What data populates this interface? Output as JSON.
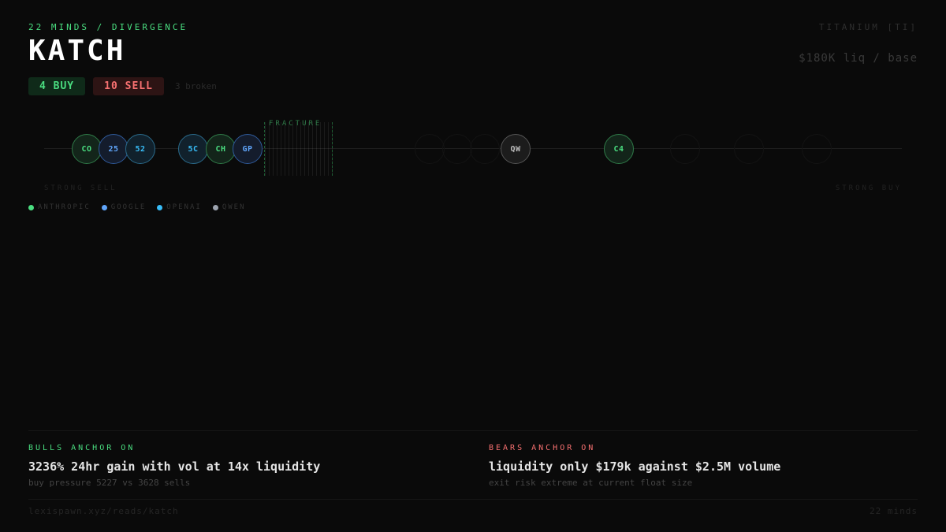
{
  "header": {
    "kicker": "22 MINDS / DIVERGENCE",
    "title": "KATCH",
    "asset": "TITANIUM [TI]",
    "liquidity": "$180K liq / base"
  },
  "badges": {
    "buy": "4 BUY",
    "sell": "10 SELL",
    "broken": "3 broken"
  },
  "track": {
    "fracture_label": "FRACTURE",
    "left_label": "STRONG SELL",
    "right_label": "STRONG BUY",
    "nodes": [
      {
        "label": "CO",
        "family": "anthropic"
      },
      {
        "label": "25",
        "family": "google"
      },
      {
        "label": "52",
        "family": "openai"
      },
      {
        "label": "5C",
        "family": "openai"
      },
      {
        "label": "CH",
        "family": "anthropic"
      },
      {
        "label": "GP",
        "family": "google"
      },
      {
        "label": "QW",
        "family": "qwen"
      },
      {
        "label": "C4",
        "family": "anthropic"
      }
    ]
  },
  "legend": [
    {
      "label": "ANTHROPIC",
      "color": "#4ade80"
    },
    {
      "label": "GOOGLE",
      "color": "#60a5fa"
    },
    {
      "label": "OPENAI",
      "color": "#38bdf8"
    },
    {
      "label": "QWEN",
      "color": "#9ca3af"
    }
  ],
  "bulls": {
    "kicker": "BULLS ANCHOR ON",
    "headline": "3236% 24hr gain with vol at 14x liquidity",
    "detail": "buy pressure 5227 vs 3628 sells"
  },
  "bears": {
    "kicker": "BEARS ANCHOR ON",
    "headline": "liquidity only $179k against $2.5M volume",
    "detail": "exit risk extreme at current float size"
  },
  "footer": {
    "url": "lexispawn.xyz/reads/katch",
    "count": "22 minds"
  }
}
